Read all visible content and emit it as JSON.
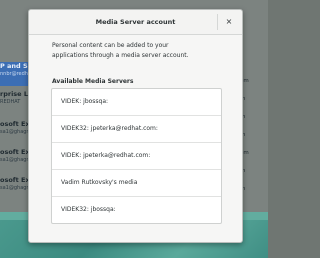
{
  "background": {
    "left_rows": [
      {
        "title": "P and SM",
        "sub": "nnbr@redhat"
      },
      {
        "title": "rprise Li",
        "sub": "REDHAT"
      },
      {
        "title": "osoft Ex",
        "sub": "sa1@ghagr"
      },
      {
        "title": "osoft Ex",
        "sub": "sa1@ghagr"
      },
      {
        "title": "osoft Ex",
        "sub": "sa1@ghagr"
      }
    ],
    "right_rows": [
      "om",
      "m",
      "m",
      "m",
      "om",
      "m",
      "m"
    ]
  },
  "dialog": {
    "title": "Media Server account",
    "close_label": "×",
    "description_line1": "Personal content can be added to your",
    "description_line2": "applications through a media server account.",
    "section_title": "Available Media Servers",
    "servers": [
      "VIDEK: jbossqa:",
      "VIDEK32: jpeterka@redhat.com:",
      "VIDEK: jpeterka@redhat.com:",
      "Vadim Rutkovsky's media",
      "VIDEK32: jbossqa:"
    ]
  }
}
